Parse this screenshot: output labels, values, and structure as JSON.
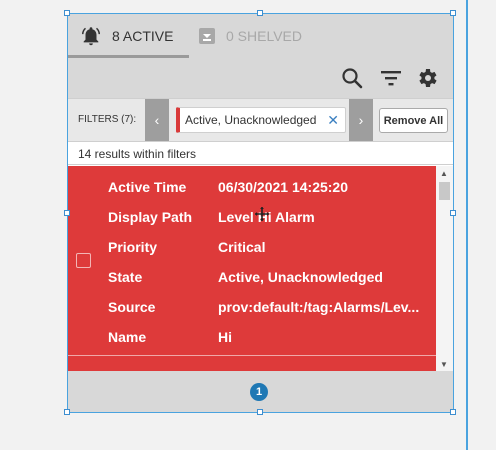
{
  "tabs": {
    "active_label": "8 ACTIVE",
    "shelved_label": "0 SHELVED"
  },
  "toolbar": {
    "icons": [
      "search-icon",
      "filter-icon",
      "gear-icon"
    ]
  },
  "filters": {
    "label": "FILTERS (7):",
    "chip_label": "Active, Unacknowledged",
    "remove_all_label": "Remove All"
  },
  "results": {
    "summary": "14 results within filters"
  },
  "alarm": {
    "color": "#de3a3a",
    "rows": [
      {
        "key": "Active Time",
        "value": "06/30/2021 14:25:20"
      },
      {
        "key": "Display Path",
        "value": "Level Hi Alarm"
      },
      {
        "key": "Priority",
        "value": "Critical"
      },
      {
        "key": "State",
        "value": "Active, Unacknowledged"
      },
      {
        "key": "Source",
        "value": "prov:default:/tag:Alarms/Lev..."
      },
      {
        "key": "Name",
        "value": "Hi"
      }
    ]
  },
  "pager": {
    "current_page": "1"
  },
  "colors": {
    "selection": "#4aa3df",
    "alarm_critical": "#de3a3a",
    "page_indicator": "#1f78b4"
  }
}
